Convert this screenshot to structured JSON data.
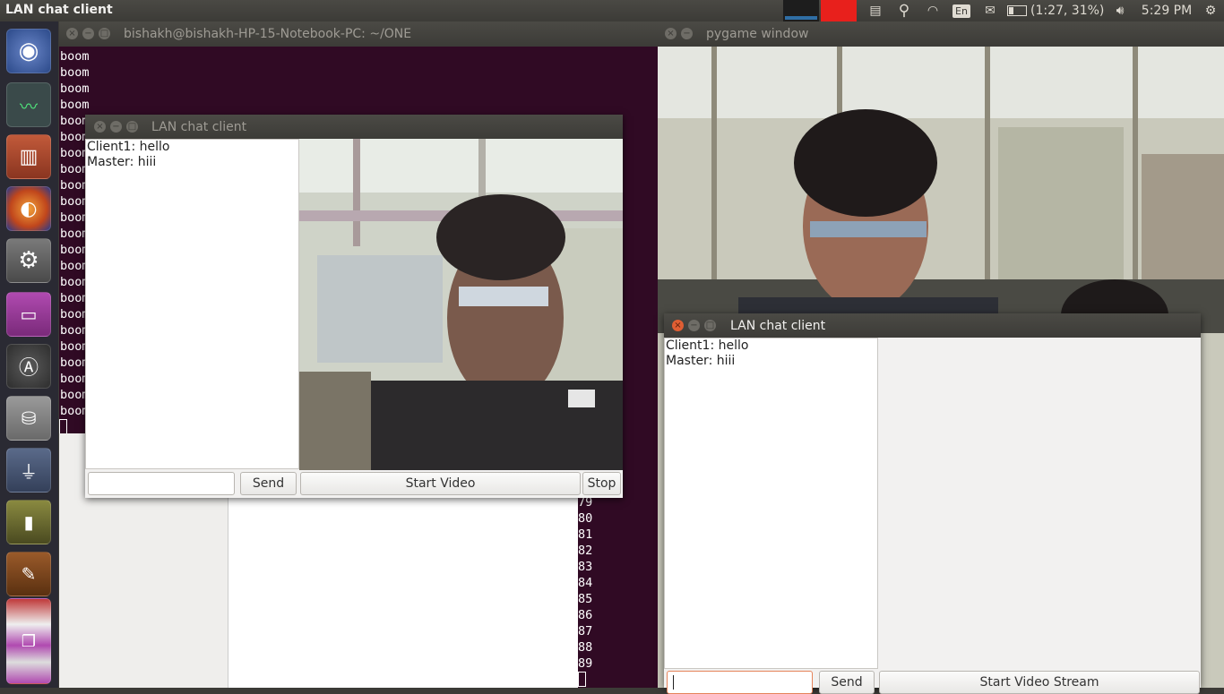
{
  "topbar": {
    "app_title": "LAN chat client",
    "battery": "(1:27, 31%)",
    "keyboard": "En",
    "clock": "5:29 PM"
  },
  "launcher": {
    "items": [
      "ubuntu-dash",
      "system-monitor",
      "files",
      "firefox",
      "system-settings",
      "workspace-switcher",
      "software-updater",
      "disk-drive",
      "usb-drive",
      "battery",
      "gimp",
      "stacked-windows"
    ]
  },
  "terminal": {
    "title": "bishakh@bishakh-HP-15-Notebook-PC: ~/ONE",
    "output_line": "boom",
    "output_count": 23,
    "numbers": [
      "79",
      "80",
      "81",
      "82",
      "83",
      "84",
      "85",
      "86",
      "87",
      "88",
      "89"
    ]
  },
  "chat_left": {
    "title": "LAN chat client",
    "messages": [
      "Client1: hello",
      "Master: hiii"
    ],
    "send_label": "Send",
    "start_label": "Start Video",
    "stop_label": "Stop"
  },
  "pygame": {
    "title": "pygame window"
  },
  "chat_right": {
    "title": "LAN chat client",
    "messages": [
      "Client1: hello",
      "Master: hiii"
    ],
    "send_label": "Send",
    "start_label": "Start Video Stream"
  },
  "colors": {
    "terminal_bg": "#300a24",
    "panel_bg": "#3c3b37",
    "launcher_bg": "#2a2a33",
    "close_accent": "#e05e33"
  }
}
